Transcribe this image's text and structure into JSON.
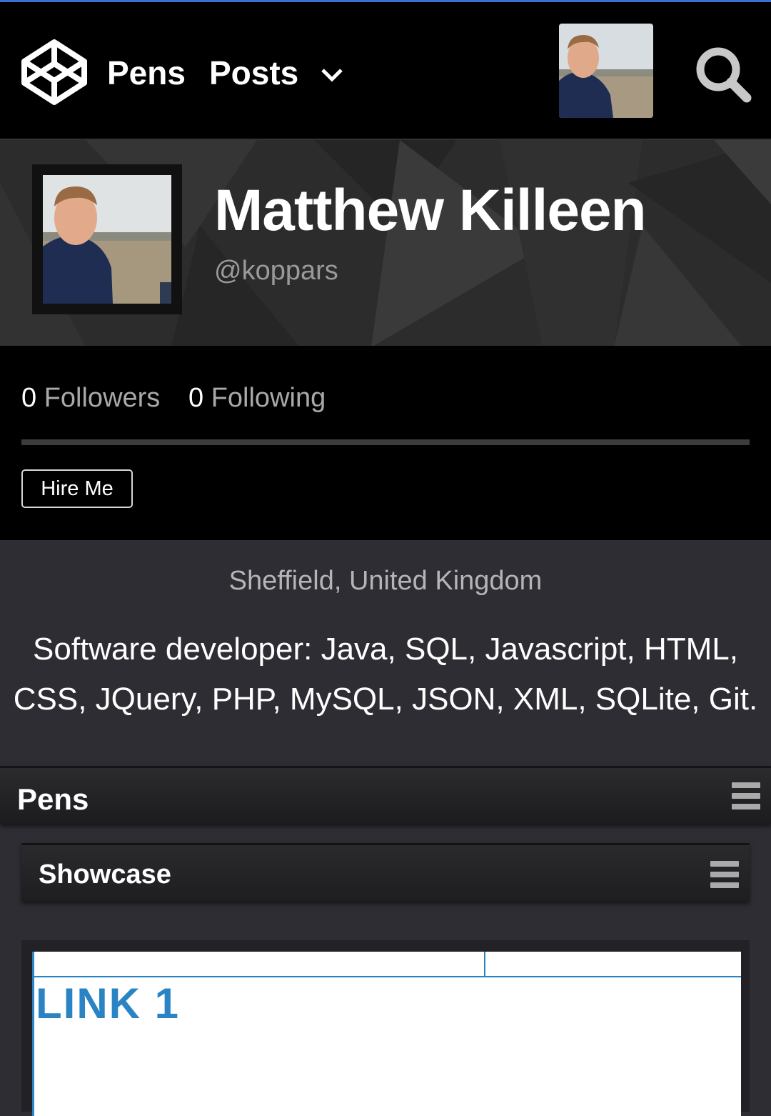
{
  "header": {
    "logo_icon": "codepen-logo-icon",
    "nav": [
      {
        "label": "Pens"
      },
      {
        "label": "Posts"
      }
    ],
    "dropdown_icon": "chevron-down-icon",
    "search_icon": "search-icon"
  },
  "profile": {
    "name": "Matthew Killeen",
    "handle": "@koppars",
    "followers_count": "0",
    "followers_label": "Followers",
    "following_count": "0",
    "following_label": "Following",
    "hire_label": "Hire Me",
    "location": "Sheffield, United Kingdom",
    "bio_line1": "Software developer: Java, SQL, Javascript, HTML,",
    "bio_line2": "CSS, JQuery, PHP, MySQL, JSON, XML, SQLite, Git."
  },
  "pens_section": {
    "title": "Pens",
    "menu_icon": "hamburger-menu-icon"
  },
  "showcase": {
    "title": "Showcase",
    "menu_icon": "hamburger-menu-icon",
    "preview_link_text": "LINK 1"
  },
  "colors": {
    "accent_blue": "#2a84c4",
    "top_line": "#3b6fd6",
    "header_bg": "#000000",
    "page_bg": "#2d2d33"
  }
}
